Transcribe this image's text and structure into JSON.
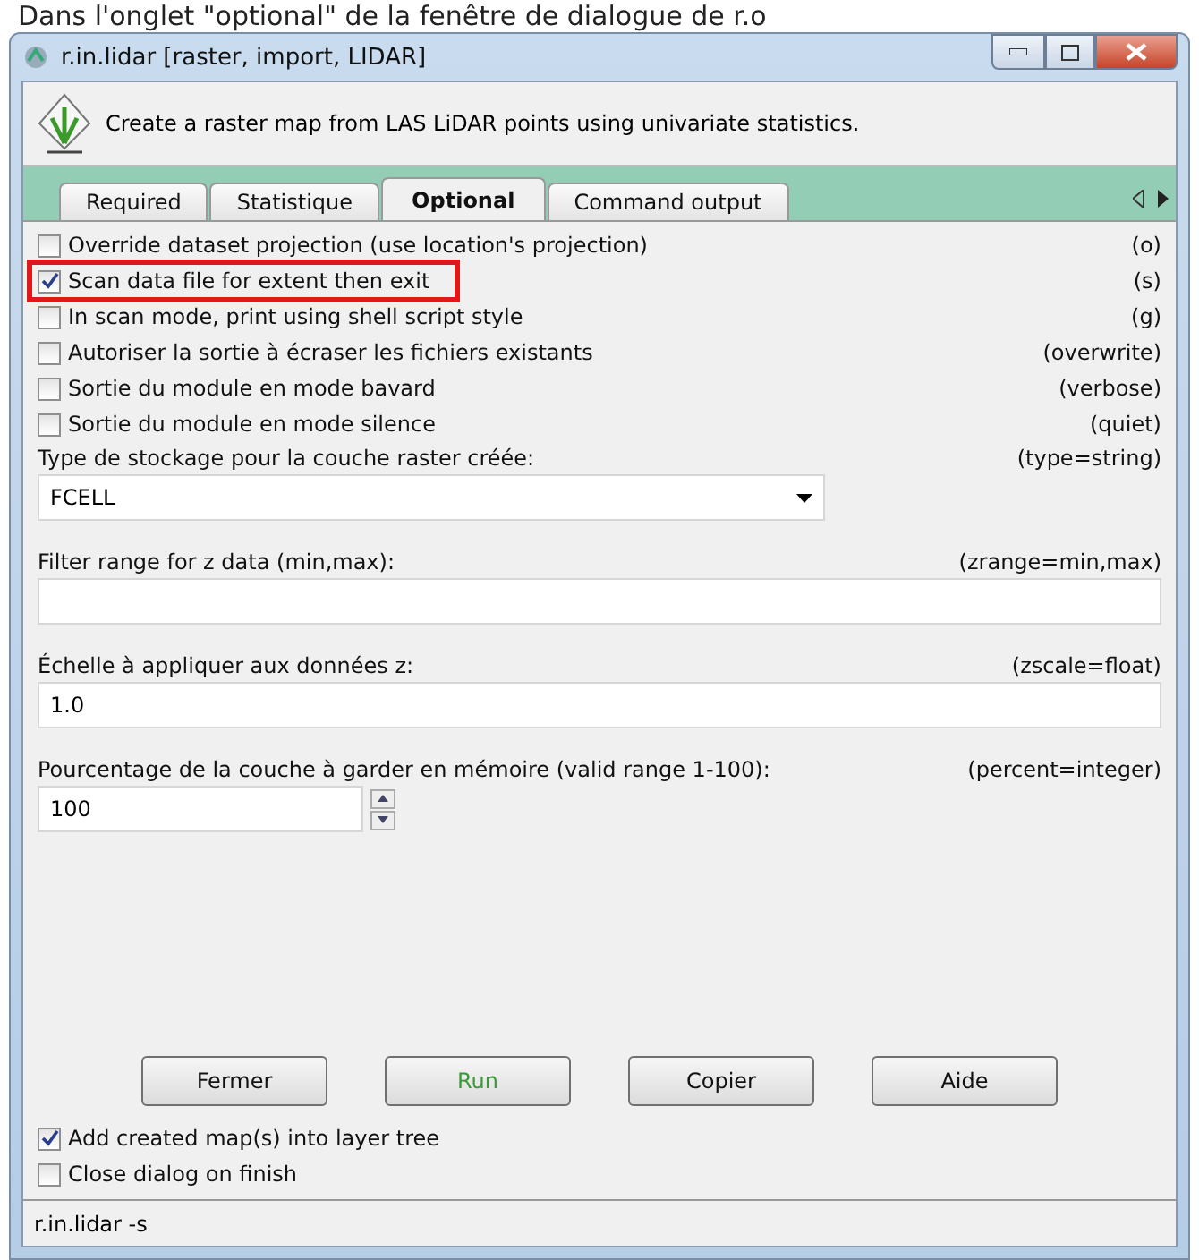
{
  "caption": "Dans l'onglet \"optional\" de la fenêtre de dialogue de r.o",
  "window": {
    "title": "r.in.lidar [raster, import, LIDAR]"
  },
  "description": "Create a raster map from LAS LiDAR points using univariate statistics.",
  "tabs": [
    {
      "label": "Required",
      "selected": false
    },
    {
      "label": "Statistique",
      "selected": false
    },
    {
      "label": "Optional",
      "selected": true
    },
    {
      "label": "Command output",
      "selected": false
    }
  ],
  "options": [
    {
      "kind": "checkbox",
      "label": "Override dataset projection (use location's projection)",
      "flag": "(o)",
      "checked": false,
      "highlighted": false
    },
    {
      "kind": "checkbox",
      "label": "Scan data file for extent then exit",
      "flag": "(s)",
      "checked": true,
      "highlighted": true
    },
    {
      "kind": "checkbox",
      "label": "In scan mode, print using shell script style",
      "flag": "(g)",
      "checked": false,
      "highlighted": false
    },
    {
      "kind": "checkbox",
      "label": "Autoriser la sortie à écraser les fichiers existants",
      "flag": "(overwrite)",
      "checked": false,
      "highlighted": false
    },
    {
      "kind": "checkbox",
      "label": "Sortie du module en mode bavard",
      "flag": "(verbose)",
      "checked": false,
      "highlighted": false
    },
    {
      "kind": "checkbox",
      "label": "Sortie du module en mode silence",
      "flag": "(quiet)",
      "checked": false,
      "highlighted": false
    },
    {
      "kind": "select",
      "label": "Type de stockage pour la couche raster créée:",
      "flag": "(type=string)",
      "value": "FCELL"
    },
    {
      "kind": "text",
      "label": "Filter range for z data (min,max):",
      "flag": "(zrange=min,max)"
    },
    {
      "kind": "text",
      "label": "Échelle à appliquer aux données z:",
      "flag": "(zscale=float)",
      "value": "1.0"
    },
    {
      "kind": "spin",
      "label": "Pourcentage de la couche à garder en mémoire (valid range 1-100):",
      "flag": "(percent=integer)",
      "value": "100"
    }
  ],
  "buttons": [
    {
      "label": "Fermer",
      "kind": "normal"
    },
    {
      "label": "Run",
      "kind": "primary"
    },
    {
      "label": "Copier",
      "kind": "normal"
    },
    {
      "label": "Aide",
      "kind": "normal"
    }
  ],
  "footer_options": [
    {
      "label": "Add created map(s) into layer tree",
      "checked": true
    },
    {
      "label": "Close dialog on finish",
      "checked": false
    }
  ],
  "status_bar": "r.in.lidar -s"
}
